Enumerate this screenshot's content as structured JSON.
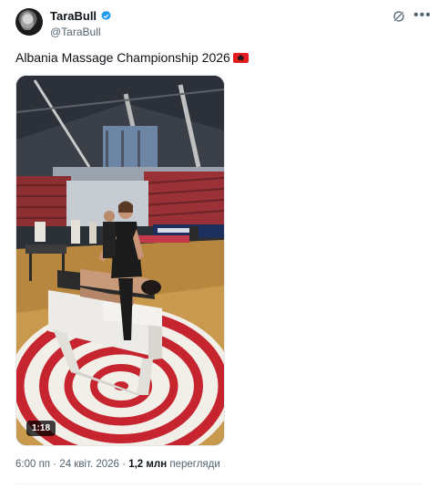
{
  "author": {
    "display_name": "TaraBull",
    "handle": "@TaraBull",
    "verified": true,
    "verified_color": "#1d9bf0",
    "avatar_icon": "profile-avatar"
  },
  "post": {
    "text": "Albania Massage Championship 2026",
    "flag_icon": "albania-flag-emoji",
    "video_duration": "1:18"
  },
  "meta": {
    "time": "6:00 пп",
    "separator": "·",
    "date": "24 квіт. 2026",
    "views_count": "1,2 млн",
    "views_label": "перегляди"
  },
  "icons": {
    "grok": "grok-icon",
    "more": "more-options-icon"
  }
}
